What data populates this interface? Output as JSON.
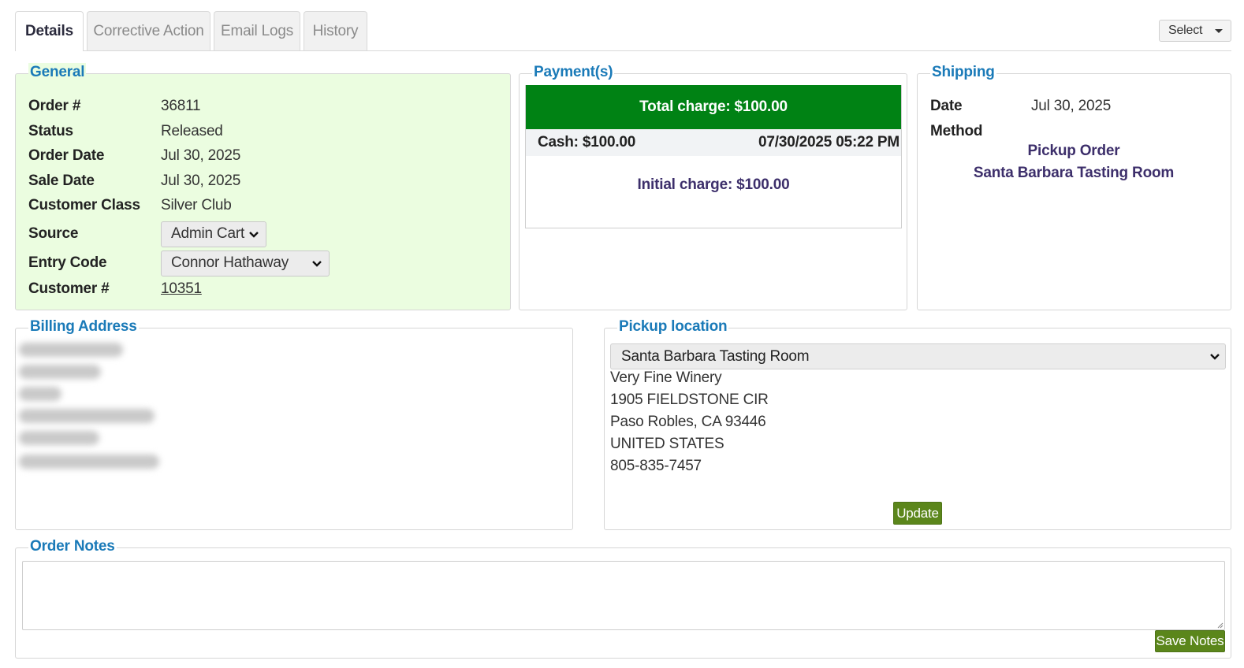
{
  "tabs": [
    {
      "label": "Details"
    },
    {
      "label": "Corrective Action"
    },
    {
      "label": "Email Logs"
    },
    {
      "label": "History"
    }
  ],
  "select_menu": {
    "label": "Select"
  },
  "general": {
    "legend": "General",
    "order_no_label": "Order #",
    "order_no": "36811",
    "status_label": "Status",
    "status": "Released",
    "order_date_label": "Order Date",
    "order_date": "Jul 30, 2025",
    "sale_date_label": "Sale Date",
    "sale_date": "Jul 30, 2025",
    "customer_class_label": "Customer Class",
    "customer_class": "Silver Club",
    "source_label": "Source",
    "source": "Admin Cart",
    "entry_code_label": "Entry Code",
    "entry_code": "Connor Hathaway",
    "customer_no_label": "Customer #",
    "customer_no": "10351"
  },
  "payments": {
    "legend": "Payment(s)",
    "total_charge": "Total charge: $100.00",
    "cash": "Cash: $100.00",
    "timestamp": "07/30/2025 05:22 PM",
    "initial_charge": "Initial charge: $100.00"
  },
  "shipping": {
    "legend": "Shipping",
    "date_label": "Date",
    "date": "Jul 30, 2025",
    "method_label": "Method",
    "method": "Pickup Order",
    "location": "Santa Barbara Tasting Room"
  },
  "billing": {
    "legend": "Billing Address"
  },
  "pickup": {
    "legend": "Pickup location",
    "selected": "Santa Barbara Tasting Room",
    "lines": [
      "Very Fine Winery",
      "1905 FIELDSTONE CIR",
      "Paso Robles, CA 93446",
      "UNITED STATES",
      "805-835-7457"
    ],
    "update_label": "Update"
  },
  "notes": {
    "legend": "Order Notes",
    "value": "",
    "save_label": "Save Notes"
  },
  "colors": {
    "legend_blue": "#1a7ab8",
    "general_bg": "#ebfde0",
    "total_bar": "#008214",
    "button_green": "#5b861b",
    "purple_text": "#3d2f6b"
  }
}
